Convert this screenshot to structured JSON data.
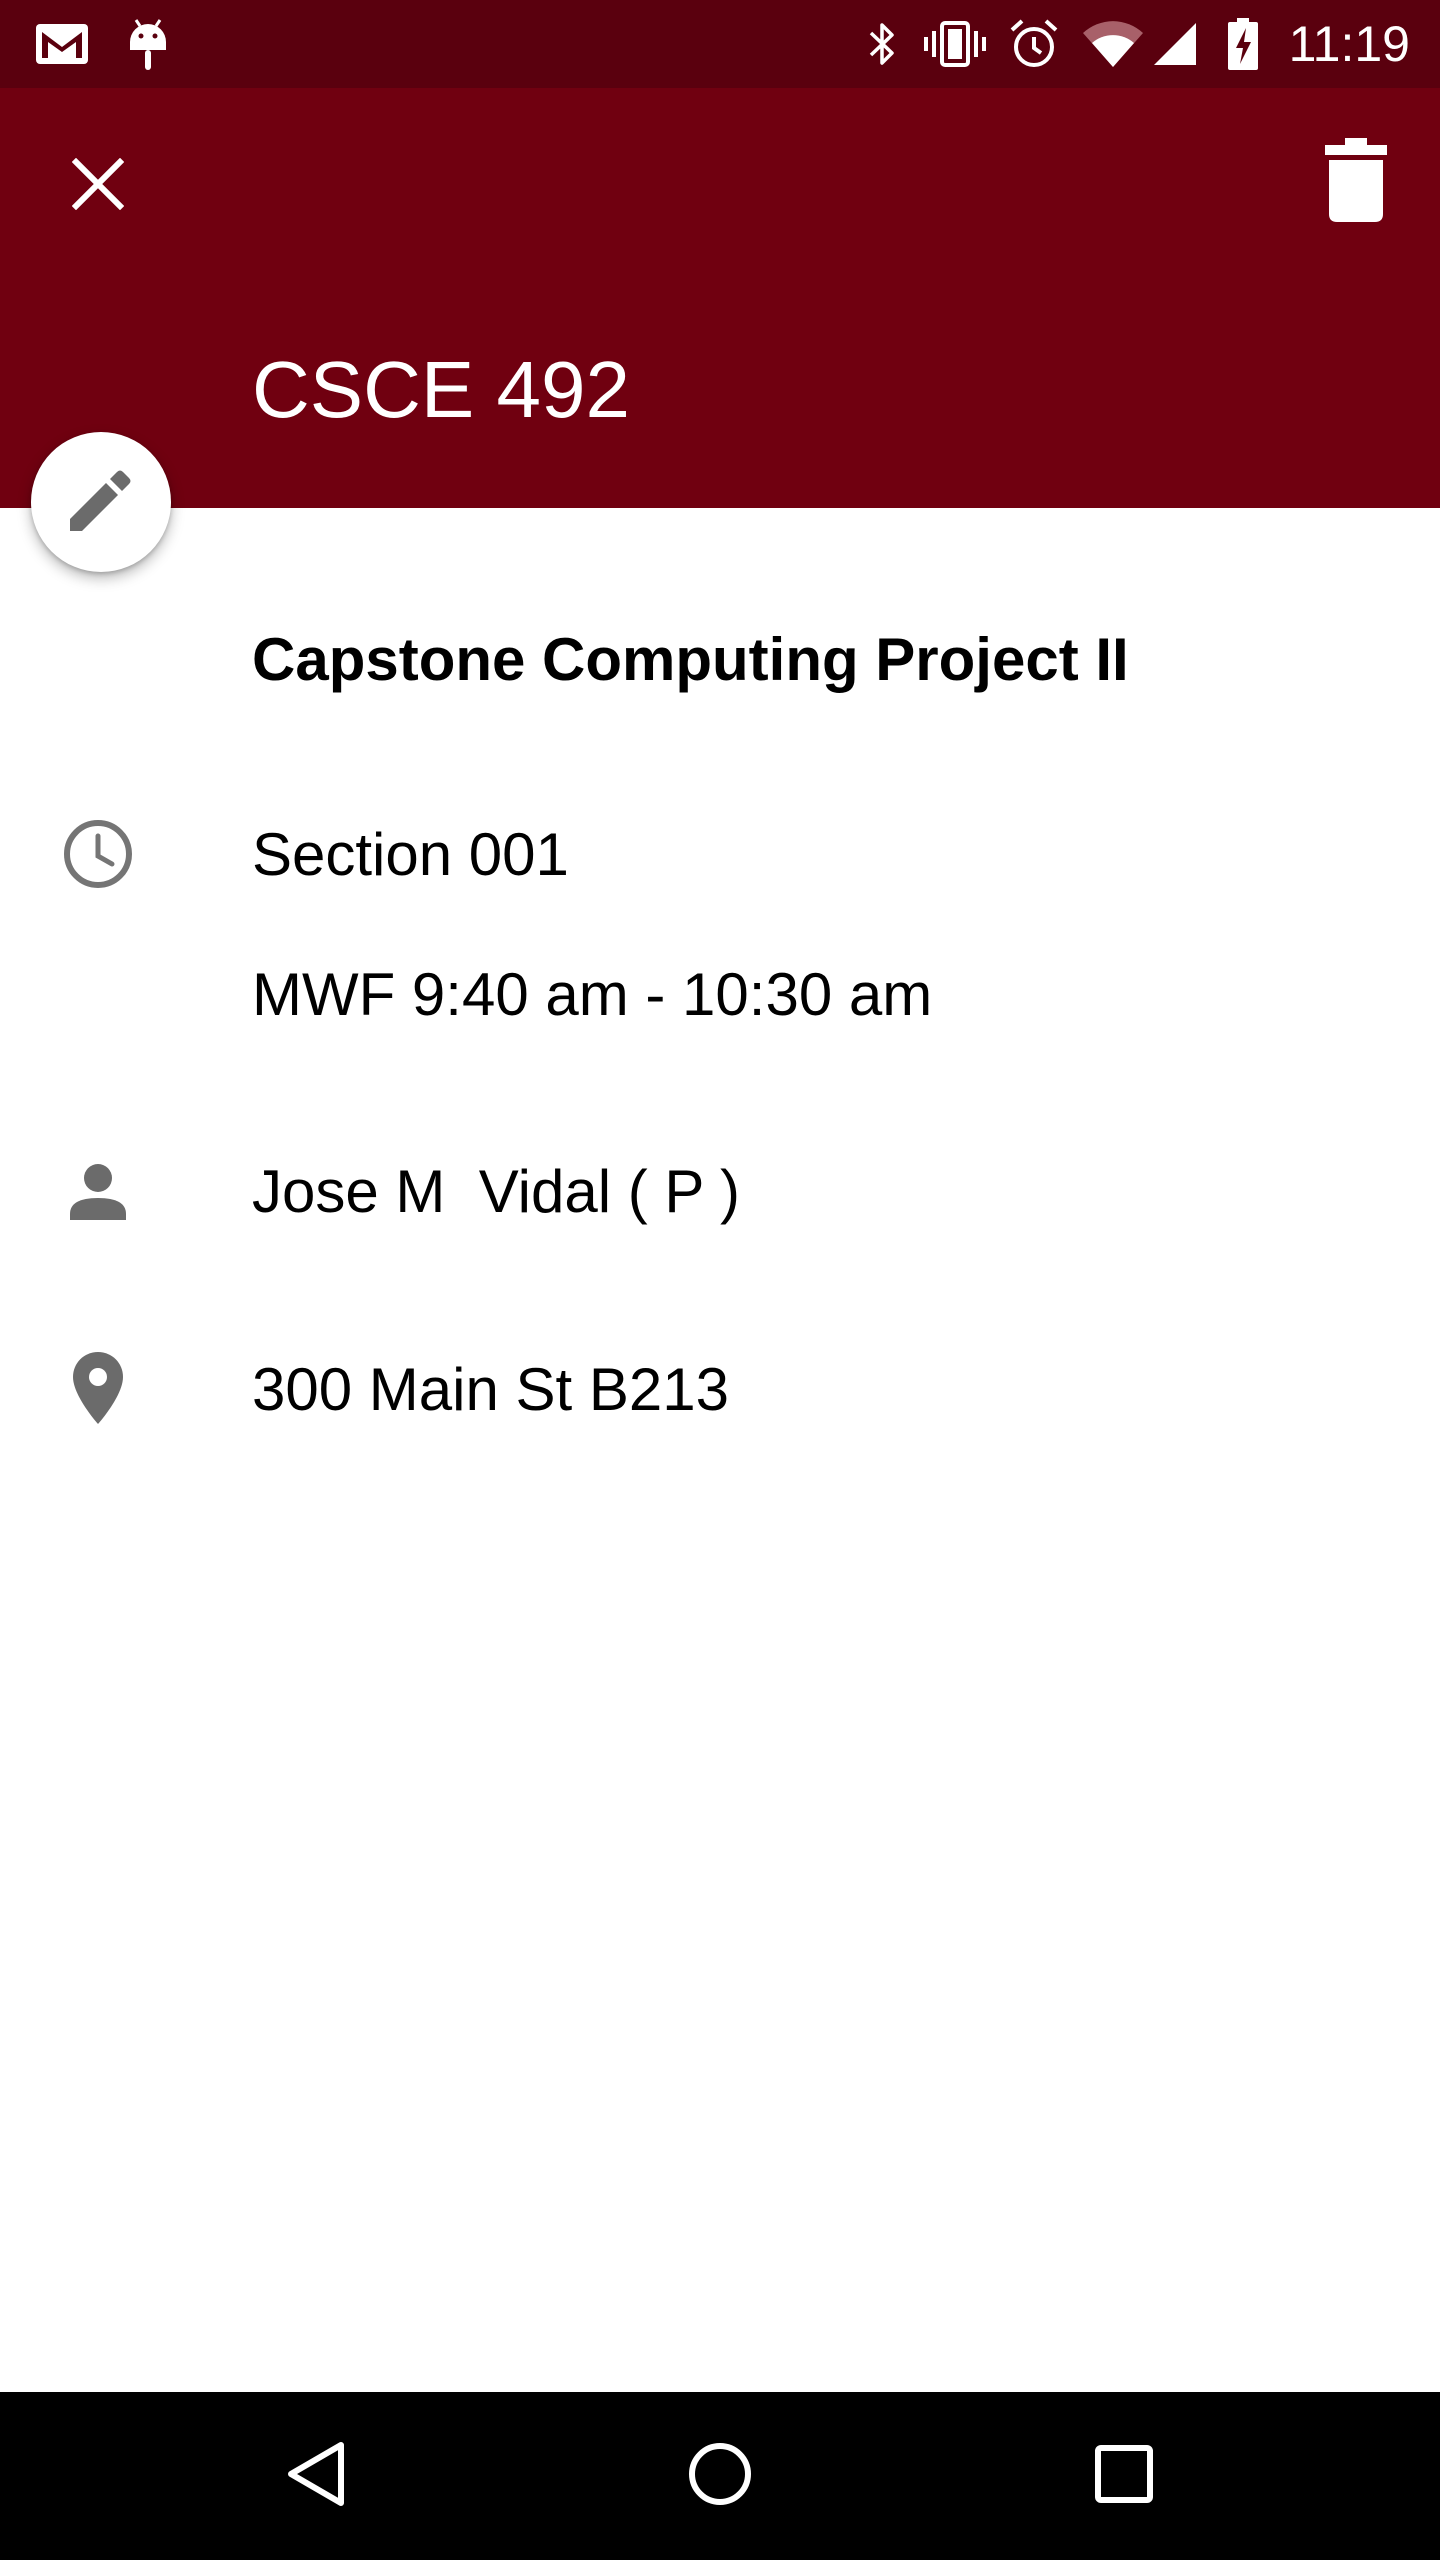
{
  "status_bar": {
    "time": "11:19",
    "notification_icons": [
      "gmail-icon",
      "android-debug-icon"
    ],
    "system_icons": [
      "bluetooth-icon",
      "vibrate-icon",
      "alarm-icon",
      "wifi-icon",
      "signal-icon",
      "battery-charging-icon"
    ]
  },
  "app_bar": {
    "title": "CSCE 492",
    "close_icon": "close-icon",
    "delete_icon": "delete-icon",
    "background_color": "#700010"
  },
  "fab": {
    "icon": "edit-icon"
  },
  "details": {
    "course_name": "Capstone Computing Project II",
    "section": "Section 001",
    "schedule": "MWF 9:40 am - 10:30 am",
    "instructor": "Jose M  Vidal ( P )",
    "location": "300 Main St B213"
  },
  "nav_bar": {
    "buttons": [
      "back-icon",
      "home-icon",
      "recents-icon"
    ]
  }
}
